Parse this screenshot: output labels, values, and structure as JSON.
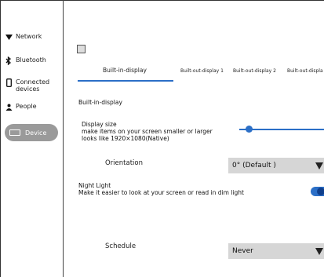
{
  "sidebar": {
    "items": [
      {
        "label": "Network",
        "icon": "wifi-icon"
      },
      {
        "label": "Bluetooth",
        "icon": "bluetooth-icon"
      },
      {
        "label": "Connected devices",
        "icon": "devices-icon"
      },
      {
        "label": "People",
        "icon": "person-icon"
      },
      {
        "label": "Device",
        "icon": "monitor-icon",
        "selected": true
      }
    ]
  },
  "tabs": {
    "items": [
      {
        "label": "Built-in-display",
        "active": true
      },
      {
        "label": "Built-out-display 1"
      },
      {
        "label": "Built-out-display 2"
      },
      {
        "label": "Built-out-displa"
      }
    ]
  },
  "section": {
    "title": "Built-in-display"
  },
  "display_size": {
    "title": "Display size",
    "line1": "make items on your screen smaller or larger",
    "line2": "looks like 1920×1080(Native)",
    "slider_level": 0.08
  },
  "orientation": {
    "label": "Orientation",
    "value": "0° (Default )"
  },
  "night_light": {
    "title": "Night Light",
    "description": "Make it easier to look at your screen or read in dim light",
    "enabled": true
  },
  "schedule": {
    "label": "Schedule",
    "value": "Never"
  },
  "colors": {
    "accent": "#2b6fc7",
    "sidebar_selected": "#9a9a9a",
    "dropdown_bg": "#d6d6d6"
  }
}
